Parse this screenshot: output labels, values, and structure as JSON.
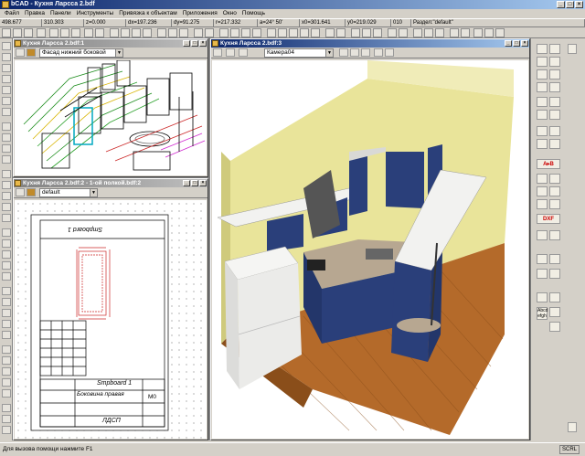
{
  "app": {
    "title": "bCAD - Кухня Ларсса 2.bdf",
    "min": "_",
    "max": "□",
    "close": "×"
  },
  "menu": [
    "Файл",
    "Правка",
    "Панели",
    "Инструменты",
    "Привязка к объектам",
    "Приложения",
    "Окно",
    "Помощь"
  ],
  "coords": [
    "498.677",
    "310.303",
    "z=0.000",
    "dx=197.236",
    "dy=91.275",
    "r=217.332",
    "a=24° 50'",
    "x0=301.641",
    "y0=219.029",
    "010",
    "Раздел:\"default\""
  ],
  "windows": {
    "view1": {
      "title": "Кухня Ларсса 2.bdf:1",
      "combo": "Фасад нижний боковой"
    },
    "view2": {
      "title": "Кухня Ларсса 2.bdf:2 - 1-ой полкой.bdf:2",
      "combo": "default"
    },
    "view3": {
      "title": "Кухня Ларсса 2.bdf:3",
      "combo": "Камера04"
    }
  },
  "drawing": {
    "stamp1": "Smpboard 1",
    "stamp2": "Боковина правая",
    "stamp3": "ЛДСП",
    "stamp4": "M0",
    "rotated_label": "Smpboard 1"
  },
  "rightbar": {
    "text_tool_1": "A▸B",
    "text_tool_2": "DXF",
    "text_tool_3": "Abcd efgh"
  },
  "status": {
    "help": "Для вызова помощи нажмите F1",
    "scrl": "SCRL"
  },
  "colors": {
    "wall": "#e9e49a",
    "floor": "#b46a2a",
    "cabinet": "#2a3f7a",
    "counter": "#e0e0de"
  }
}
